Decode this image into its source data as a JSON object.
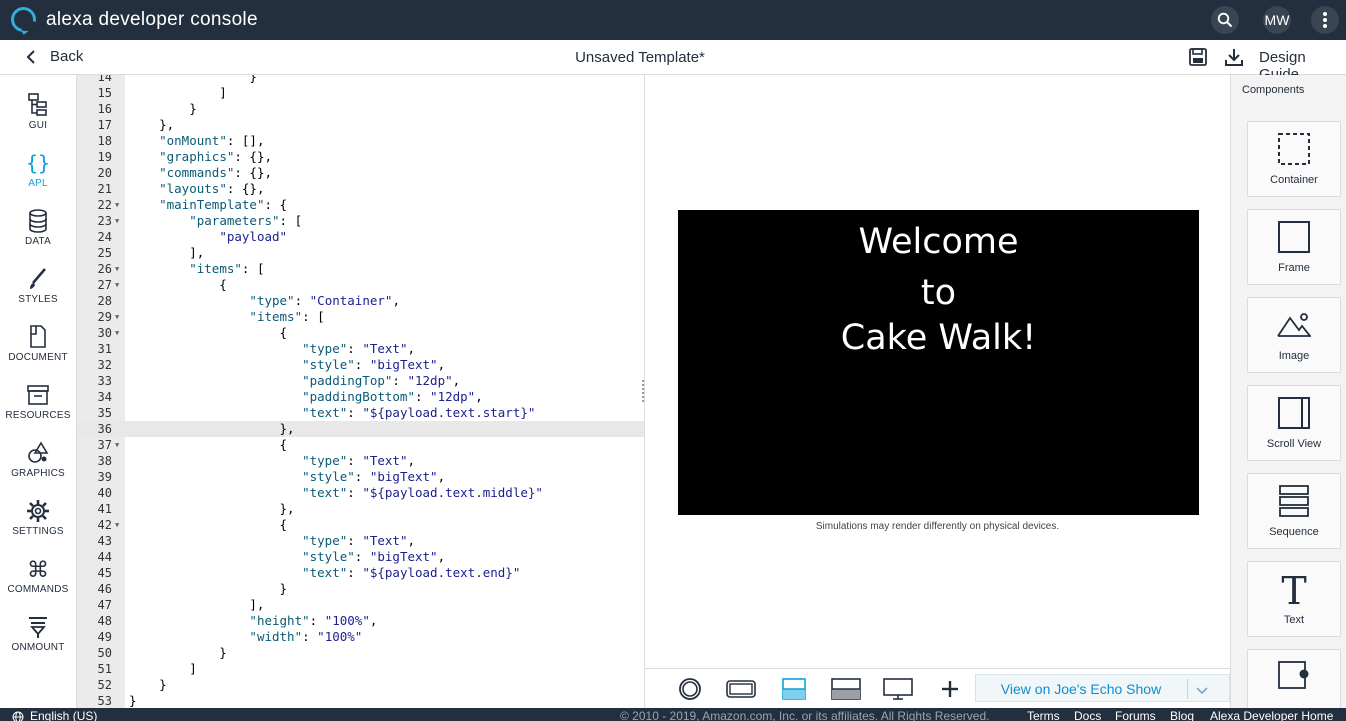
{
  "topbar": {
    "brand": "alexa developer console",
    "avatar": "MW"
  },
  "subbar": {
    "back_label": "Back",
    "title": "Unsaved Template*",
    "design_guide": "Design Guide"
  },
  "nav": [
    {
      "label": "GUI"
    },
    {
      "label": "APL"
    },
    {
      "label": "DATA"
    },
    {
      "label": "STYLES"
    },
    {
      "label": "DOCUMENT"
    },
    {
      "label": "RESOURCES"
    },
    {
      "label": "GRAPHICS"
    },
    {
      "label": "SETTINGS"
    },
    {
      "label": "COMMANDS"
    },
    {
      "label": "ONMOUNT"
    }
  ],
  "editor": {
    "lines": [
      {
        "n": "14",
        "fold": false,
        "text": "                }"
      },
      {
        "n": "15",
        "fold": false,
        "text": "            ]"
      },
      {
        "n": "16",
        "fold": false,
        "text": "        }"
      },
      {
        "n": "17",
        "fold": false,
        "text": "    },"
      },
      {
        "n": "18",
        "fold": false,
        "text": "    \"onMount\": [],"
      },
      {
        "n": "19",
        "fold": false,
        "text": "    \"graphics\": {},"
      },
      {
        "n": "20",
        "fold": false,
        "text": "    \"commands\": {},"
      },
      {
        "n": "21",
        "fold": false,
        "text": "    \"layouts\": {},"
      },
      {
        "n": "22",
        "fold": true,
        "text": "    \"mainTemplate\": {"
      },
      {
        "n": "23",
        "fold": true,
        "text": "        \"parameters\": ["
      },
      {
        "n": "24",
        "fold": false,
        "text": "            \"payload\""
      },
      {
        "n": "25",
        "fold": false,
        "text": "        ],"
      },
      {
        "n": "26",
        "fold": true,
        "text": "        \"items\": ["
      },
      {
        "n": "27",
        "fold": true,
        "text": "            {"
      },
      {
        "n": "28",
        "fold": false,
        "text": "                \"type\": \"Container\","
      },
      {
        "n": "29",
        "fold": true,
        "text": "                \"items\": ["
      },
      {
        "n": "30",
        "fold": true,
        "text": "                    {"
      },
      {
        "n": "31",
        "fold": false,
        "text": "                       \"type\": \"Text\","
      },
      {
        "n": "32",
        "fold": false,
        "text": "                       \"style\": \"bigText\","
      },
      {
        "n": "33",
        "fold": false,
        "text": "                       \"paddingTop\": \"12dp\","
      },
      {
        "n": "34",
        "fold": false,
        "text": "                       \"paddingBottom\": \"12dp\","
      },
      {
        "n": "35",
        "fold": false,
        "text": "                       \"text\": \"${payload.text.start}\""
      },
      {
        "n": "36",
        "fold": false,
        "text": "                    },"
      },
      {
        "n": "37",
        "fold": true,
        "text": "                    {"
      },
      {
        "n": "38",
        "fold": false,
        "text": "                       \"type\": \"Text\","
      },
      {
        "n": "39",
        "fold": false,
        "text": "                       \"style\": \"bigText\","
      },
      {
        "n": "40",
        "fold": false,
        "text": "                       \"text\": \"${payload.text.middle}\""
      },
      {
        "n": "41",
        "fold": false,
        "text": "                    },"
      },
      {
        "n": "42",
        "fold": true,
        "text": "                    {"
      },
      {
        "n": "43",
        "fold": false,
        "text": "                       \"type\": \"Text\","
      },
      {
        "n": "44",
        "fold": false,
        "text": "                       \"style\": \"bigText\","
      },
      {
        "n": "45",
        "fold": false,
        "text": "                       \"text\": \"${payload.text.end}\""
      },
      {
        "n": "46",
        "fold": false,
        "text": "                    }"
      },
      {
        "n": "47",
        "fold": false,
        "text": "                ],"
      },
      {
        "n": "48",
        "fold": false,
        "text": "                \"height\": \"100%\","
      },
      {
        "n": "49",
        "fold": false,
        "text": "                \"width\": \"100%\""
      },
      {
        "n": "50",
        "fold": false,
        "text": "            }"
      },
      {
        "n": "51",
        "fold": false,
        "text": "        ]"
      },
      {
        "n": "52",
        "fold": false,
        "text": "    }"
      },
      {
        "n": "53",
        "fold": false,
        "text": "}"
      }
    ],
    "highlighted_line": "36"
  },
  "preview": {
    "screen_lines": [
      "Welcome",
      "to",
      "Cake Walk!"
    ],
    "disclaimer": "Simulations may render differently on physical devices.",
    "view_button": "View on Joe's Echo Show"
  },
  "components": {
    "title": "Components",
    "items": [
      {
        "label": "Container"
      },
      {
        "label": "Frame"
      },
      {
        "label": "Image"
      },
      {
        "label": "Scroll View"
      },
      {
        "label": "Sequence"
      },
      {
        "label": "Text"
      }
    ]
  },
  "footer": {
    "language": "English (US)",
    "copyright": "© 2010 - 2019, Amazon.com, Inc. or its affiliates. All Rights Reserved.",
    "links": [
      "Terms",
      "Docs",
      "Forums",
      "Blog",
      "Alexa Developer Home"
    ]
  }
}
